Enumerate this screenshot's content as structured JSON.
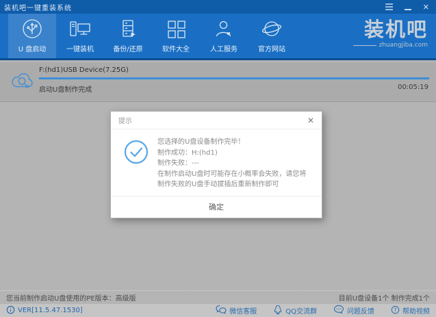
{
  "window": {
    "title": "装机吧一键重装系统"
  },
  "toolbar": {
    "items": [
      {
        "label": "U 盘启动",
        "icon": "usb-icon",
        "active": true
      },
      {
        "label": "一键装机",
        "icon": "computer-icon",
        "active": false
      },
      {
        "label": "备份/还原",
        "icon": "backup-restore-icon",
        "active": false
      },
      {
        "label": "软件大全",
        "icon": "software-grid-icon",
        "active": false
      },
      {
        "label": "人工服务",
        "icon": "support-person-icon",
        "active": false
      },
      {
        "label": "官方网站",
        "icon": "globe-icon",
        "active": false
      }
    ],
    "logo": {
      "text": "装机吧",
      "domain": "zhuangjiba.com"
    }
  },
  "device_panel": {
    "device_name": "F:(hd1)USB Device(7.25G)",
    "status_text": "启动U盘制作完成",
    "elapsed_time": "00:05:19",
    "progress_percent": 100
  },
  "dialog": {
    "title": "提示",
    "close_label": "✕",
    "lines": [
      "您选择的U盘设备制作完毕！",
      "制作成功：H:(hd1)",
      "制作失败：---",
      "在制作启动U盘时可能存在小概率会失败，请您将制作失败的U盘手动拔插后重新制作即可"
    ],
    "confirm_label": "确定"
  },
  "footer": {
    "pe_version_text": "您当前制作启动U盘使用的PE版本：高级版",
    "usb_summary_text": "目前U盘设备1个 制作完成1个"
  },
  "statusbar": {
    "version": "VER[11.5.47.1530]",
    "links": [
      {
        "label": "微信客服",
        "icon": "wechat-icon"
      },
      {
        "label": "QQ交流群",
        "icon": "qq-icon"
      },
      {
        "label": "问题反馈",
        "icon": "feedback-icon"
      },
      {
        "label": "帮助视频",
        "icon": "help-icon"
      }
    ]
  },
  "colors": {
    "titlebar_blue": "#0f5ca9",
    "toolbar_blue": "#1a6fc4",
    "toolbar_active": "rgba(255,255,255,0.14)",
    "progress_blue": "#3e8ed8",
    "check_blue": "#58a6e6",
    "link_blue": "#2a6cb0",
    "dim_gray": "#b4b4b4"
  }
}
